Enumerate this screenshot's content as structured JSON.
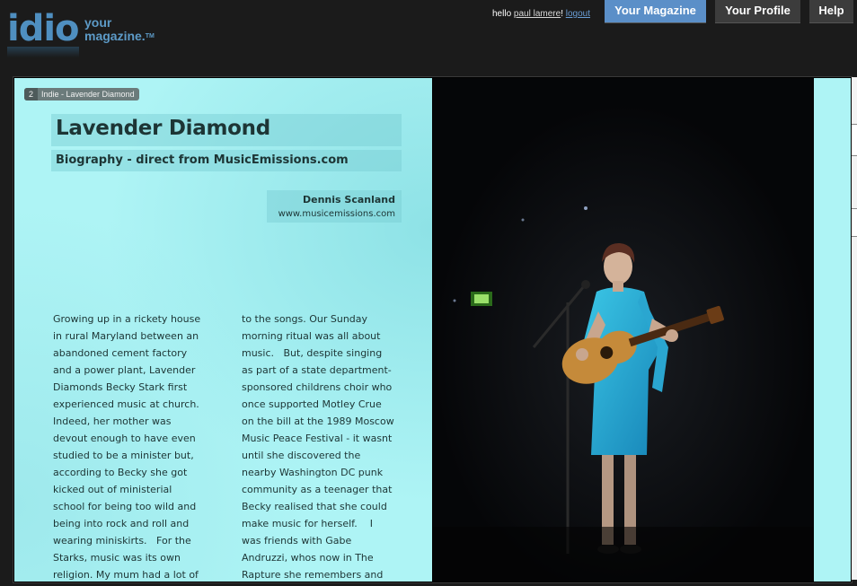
{
  "header": {
    "logo_word": "idio",
    "logo_tag_line1": "your",
    "logo_tag_line2": "magazine.",
    "logo_tm": "TM",
    "greeting": "hello",
    "username": "paul lamere",
    "exclaim": "!",
    "logout": "logout",
    "nav": {
      "your_magazine": "Your Magazine",
      "your_profile": "Your Profile",
      "help": "Help"
    }
  },
  "article": {
    "page_number": "2",
    "breadcrumb": "Indie - Lavender Diamond",
    "title": "Lavender Diamond",
    "subtitle": "Biography - direct from MusicEmissions.com",
    "author": "Dennis Scanland",
    "source_url": "www.musicemissions.com",
    "column1": [
      "Growing up in a rickety house",
      "in rural Maryland between an",
      "abandoned cement factory",
      "and a power plant, Lavender",
      "Diamonds Becky Stark first",
      "experienced music at church.",
      "Indeed, her mother was",
      "devout enough to have even",
      "studied to be a minister but,",
      "according to Becky she got",
      "kicked out of ministerial",
      "school for being too wild and",
      "being into rock and roll and",
      "wearing miniskirts.   For the",
      "Starks, music was its own",
      "religion. My mum had a lot of"
    ],
    "column2": [
      "to the songs. Our Sunday",
      "morning ritual was all about",
      "music.   But, despite singing",
      "as part of a state department-",
      "sponsored childrens choir who",
      "once supported Motley Crue",
      "on the bill at the 1989 Moscow",
      "Music Peace Festival - it wasnt",
      "until she discovered the",
      "nearby Washington DC punk",
      "community as a teenager that",
      "Becky realised that she could",
      "make music for herself.    I",
      "was friends with Gabe",
      "Andruzzi, whos now in The",
      "Rapture she remembers and"
    ]
  },
  "colors": {
    "nav_active": "#5b8fc8",
    "nav_inactive": "#3c3c3c",
    "page_bg": "#aef4f5",
    "text_dark": "#1d3535"
  }
}
